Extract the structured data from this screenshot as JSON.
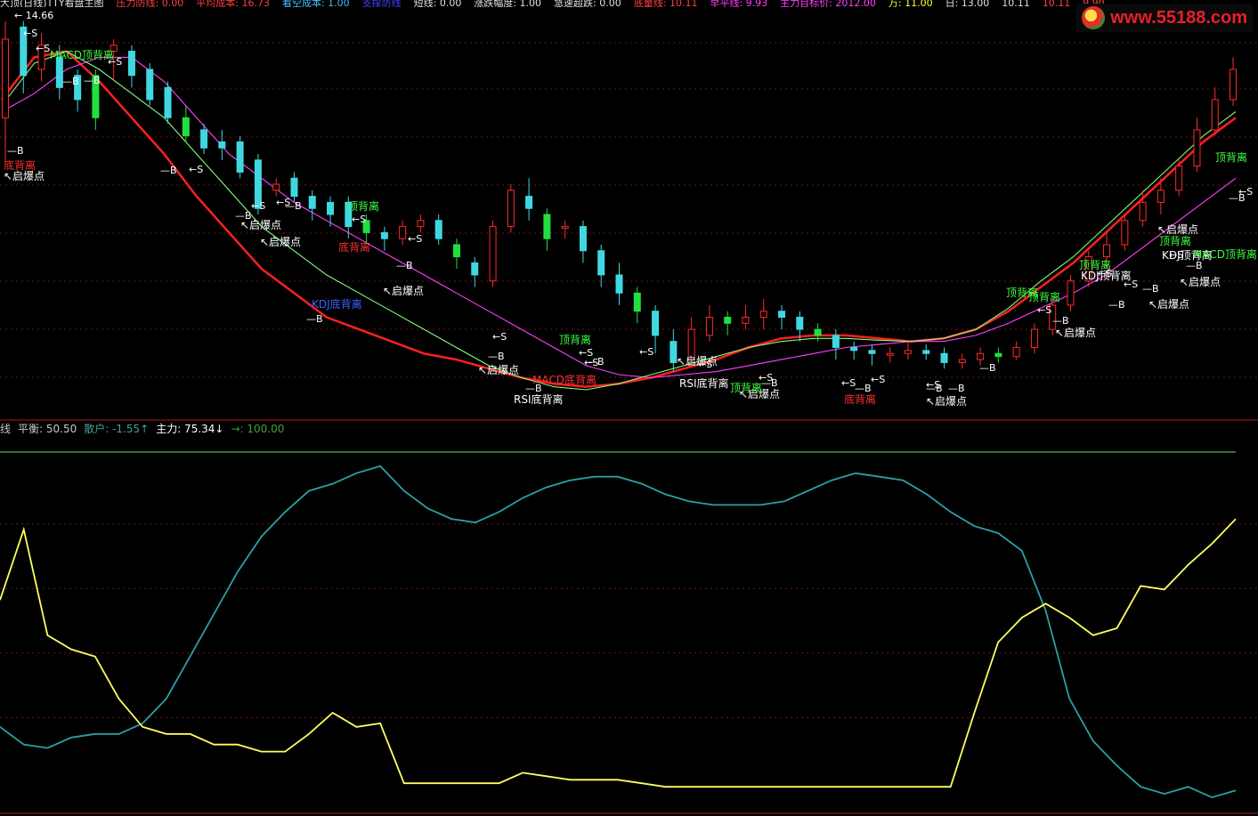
{
  "top_bar": [
    {
      "text": "大顶(日线)TTY看盘主图",
      "color": "#e0e0e0"
    },
    {
      "text": "压力防线: 0.00",
      "color": "#ff4040"
    },
    {
      "text": "平均成本: 16.73",
      "color": "#ff4040"
    },
    {
      "text": "看空成本: 1.00",
      "color": "#40c0ff"
    },
    {
      "text": "支撑防线",
      "color": "#4040ff"
    },
    {
      "text": "短线: 0.00",
      "color": "#e0e0e0"
    },
    {
      "text": "涨跌幅度: 1.00",
      "color": "#e0e0e0"
    },
    {
      "text": "急速超跌: 0.00",
      "color": "#e0e0e0"
    },
    {
      "text": "底量线: 10.11",
      "color": "#ff4040"
    },
    {
      "text": "早平线: 9.93",
      "color": "#ff40ff"
    },
    {
      "text": "主力目标价: 2012.00",
      "color": "#ff40ff"
    },
    {
      "text": "万: 11.00",
      "color": "#ffff40"
    },
    {
      "text": "日: 13.00",
      "color": "#e0e0e0"
    },
    {
      "text": "10.11",
      "color": "#e0e0e0"
    },
    {
      "text": "10.11",
      "color": "#ff4040"
    },
    {
      "text": "9.90",
      "color": "#ff4040"
    }
  ],
  "logo": {
    "text": "www.55188.com"
  },
  "chart_data": [
    {
      "type": "candlestick",
      "price_label": "14.66",
      "series": [
        {
          "name": "",
          "color": "#ff2020",
          "values": [
            12.9,
            13.6,
            13.7,
            13.2,
            12.6,
            12.0,
            11.3,
            10.7,
            10.1,
            9.7,
            9.3,
            9.1,
            8.9,
            8.7,
            8.6,
            8.45,
            8.3,
            8.2,
            8.15,
            8.2,
            8.3,
            8.45,
            8.6,
            8.8,
            8.95,
            9.0,
            9.0,
            8.95,
            8.9,
            8.95,
            9.1,
            9.4,
            9.8,
            10.2,
            10.7,
            11.2,
            11.7,
            12.2,
            12.6
          ]
        },
        {
          "name": "",
          "color": "#ff40ff",
          "values": [
            12.7,
            13.0,
            13.4,
            13.6,
            13.6,
            13.2,
            12.6,
            12.0,
            11.6,
            11.2,
            10.9,
            10.6,
            10.3,
            10.0,
            9.7,
            9.4,
            9.1,
            8.8,
            8.5,
            8.35,
            8.3,
            8.35,
            8.4,
            8.5,
            8.6,
            8.7,
            8.8,
            8.85,
            8.9,
            8.9,
            9.0,
            9.2,
            9.45,
            9.7,
            10.0,
            10.4,
            10.8,
            11.2,
            11.6
          ]
        },
        {
          "name": "",
          "color": "#80ff80",
          "values": [
            12.8,
            13.5,
            13.7,
            13.4,
            13.0,
            12.6,
            12.0,
            11.4,
            10.8,
            10.4,
            10.0,
            9.7,
            9.4,
            9.1,
            8.8,
            8.5,
            8.3,
            8.15,
            8.1,
            8.2,
            8.35,
            8.5,
            8.65,
            8.8,
            8.9,
            8.95,
            8.95,
            8.92,
            8.9,
            8.95,
            9.1,
            9.45,
            9.9,
            10.3,
            10.8,
            11.3,
            11.8,
            12.3,
            12.7
          ]
        }
      ],
      "candles": [
        [
          12.6,
          13.9,
          11.8,
          14.2
        ],
        [
          14.1,
          13.3,
          13.0,
          14.2
        ],
        [
          13.4,
          13.8,
          13.2,
          14.0
        ],
        [
          13.6,
          13.1,
          12.9,
          13.8
        ],
        [
          13.3,
          12.9,
          12.7,
          13.4
        ],
        [
          13.3,
          12.6,
          12.4,
          13.4
        ],
        [
          13.7,
          13.8,
          13.2,
          13.9
        ],
        [
          13.7,
          13.3,
          13.1,
          13.8
        ],
        [
          13.4,
          12.9,
          12.8,
          13.5
        ],
        [
          13.1,
          12.6,
          12.5,
          13.2
        ],
        [
          12.6,
          12.3,
          12.2,
          12.8
        ],
        [
          12.4,
          12.1,
          12.0,
          12.5
        ],
        [
          12.2,
          12.1,
          11.9,
          12.4
        ],
        [
          12.2,
          11.7,
          11.6,
          12.3
        ],
        [
          11.9,
          11.1,
          11.0,
          12.0
        ],
        [
          11.4,
          11.5,
          11.3,
          11.6
        ],
        [
          11.6,
          11.3,
          11.2,
          11.7
        ],
        [
          11.3,
          11.1,
          10.9,
          11.4
        ],
        [
          11.2,
          11.0,
          10.8,
          11.3
        ],
        [
          11.2,
          10.8,
          10.6,
          11.3
        ],
        [
          10.9,
          10.7,
          10.5,
          11.0
        ],
        [
          10.7,
          10.6,
          10.4,
          10.8
        ],
        [
          10.6,
          10.8,
          10.5,
          10.9
        ],
        [
          10.8,
          10.9,
          10.7,
          11.0
        ],
        [
          10.9,
          10.6,
          10.5,
          11.0
        ],
        [
          10.5,
          10.3,
          10.1,
          10.6
        ],
        [
          10.2,
          10.0,
          9.8,
          10.3
        ],
        [
          9.9,
          10.8,
          9.8,
          10.9
        ],
        [
          10.8,
          11.4,
          10.7,
          11.5
        ],
        [
          11.3,
          11.1,
          10.9,
          11.6
        ],
        [
          11.0,
          10.6,
          10.4,
          11.1
        ],
        [
          10.8,
          10.8,
          10.6,
          10.9
        ],
        [
          10.8,
          10.4,
          10.2,
          10.9
        ],
        [
          10.4,
          10.0,
          9.8,
          10.5
        ],
        [
          10.0,
          9.7,
          9.5,
          10.2
        ],
        [
          9.7,
          9.4,
          9.2,
          9.8
        ],
        [
          9.4,
          9.0,
          8.7,
          9.5
        ],
        [
          8.9,
          8.55,
          8.4,
          9.1
        ],
        [
          8.6,
          9.1,
          8.5,
          9.3
        ],
        [
          9.0,
          9.3,
          8.9,
          9.5
        ],
        [
          9.3,
          9.2,
          9.0,
          9.4
        ],
        [
          9.2,
          9.3,
          9.1,
          9.5
        ],
        [
          9.3,
          9.4,
          9.1,
          9.6
        ],
        [
          9.4,
          9.3,
          9.1,
          9.5
        ],
        [
          9.3,
          9.1,
          8.9,
          9.4
        ],
        [
          9.1,
          9.0,
          8.9,
          9.2
        ],
        [
          9.0,
          8.8,
          8.6,
          9.1
        ],
        [
          8.8,
          8.75,
          8.6,
          8.9
        ],
        [
          8.75,
          8.7,
          8.5,
          8.85
        ],
        [
          8.7,
          8.7,
          8.55,
          8.8
        ],
        [
          8.7,
          8.75,
          8.6,
          8.9
        ],
        [
          8.75,
          8.7,
          8.6,
          8.85
        ],
        [
          8.7,
          8.55,
          8.45,
          8.8
        ],
        [
          8.55,
          8.6,
          8.45,
          8.7
        ],
        [
          8.6,
          8.7,
          8.5,
          8.8
        ],
        [
          8.7,
          8.65,
          8.55,
          8.8
        ],
        [
          8.65,
          8.8,
          8.6,
          8.9
        ],
        [
          8.8,
          9.1,
          8.7,
          9.2
        ],
        [
          9.1,
          9.5,
          9.0,
          9.6
        ],
        [
          9.5,
          9.9,
          9.4,
          10.0
        ],
        [
          9.9,
          10.3,
          9.8,
          10.4
        ],
        [
          10.3,
          10.5,
          10.1,
          10.7
        ],
        [
          10.5,
          10.9,
          10.4,
          11.0
        ],
        [
          10.9,
          11.2,
          10.8,
          11.4
        ],
        [
          11.2,
          11.4,
          11.0,
          11.6
        ],
        [
          11.4,
          11.8,
          11.3,
          11.9
        ],
        [
          11.8,
          12.4,
          11.7,
          12.6
        ],
        [
          12.4,
          12.9,
          12.3,
          13.1
        ],
        [
          12.9,
          13.4,
          12.8,
          13.6
        ]
      ],
      "annotations": [
        {
          "text": "MACD顶背离",
          "color": "#40ff40"
        },
        {
          "text": "顶背离",
          "color": "#40ff40"
        },
        {
          "text": "底背离",
          "color": "#ff3030"
        },
        {
          "text": "启爆点",
          "color": "#ffffff"
        },
        {
          "text": "启爆点",
          "color": "#ffffff"
        },
        {
          "text": "启爆点",
          "color": "#ffffff"
        },
        {
          "text": "启爆点",
          "color": "#ffffff"
        },
        {
          "text": "启爆点",
          "color": "#ffffff"
        },
        {
          "text": "KDJ底背离",
          "color": "#4060ff"
        },
        {
          "text": "顶背离",
          "color": "#40ff40"
        },
        {
          "text": "底背离",
          "color": "#ff3030"
        },
        {
          "text": "启爆点",
          "color": "#ffffff"
        },
        {
          "text": "顶背离",
          "color": "#40ff40"
        },
        {
          "text": "MACD底背离",
          "color": "#ff3030"
        },
        {
          "text": "启爆点",
          "color": "#ffffff"
        },
        {
          "text": "RSI底背离",
          "color": "#ffffff"
        },
        {
          "text": "RSI底背离",
          "color": "#ffffff"
        },
        {
          "text": "启爆点",
          "color": "#ffffff"
        },
        {
          "text": "启爆点",
          "color": "#ffffff"
        },
        {
          "text": "底背离",
          "color": "#ff3030"
        },
        {
          "text": "顶背离",
          "color": "#40ff40"
        },
        {
          "text": "顶背离",
          "color": "#40ff40"
        },
        {
          "text": "启爆点",
          "color": "#ffffff"
        },
        {
          "text": "顶背离",
          "color": "#40ff40"
        },
        {
          "text": "KDJ顶背离",
          "color": "#ffffff"
        },
        {
          "text": "启爆点",
          "color": "#ffffff"
        },
        {
          "text": "顶背离",
          "color": "#40ff40"
        },
        {
          "text": "KDJ顶背离",
          "color": "#ffffff"
        },
        {
          "text": "MACD顶背离",
          "color": "#40ff40"
        },
        {
          "text": "启爆点",
          "color": "#ffffff"
        },
        {
          "text": "顶背离",
          "color": "#40ff40"
        }
      ],
      "signals_b": [
        "B",
        "B",
        "B",
        "B",
        "B",
        "B",
        "B",
        "B",
        "B",
        "B",
        "B",
        "B",
        "B",
        "B",
        "B",
        "B",
        "B",
        "B",
        "B",
        "B",
        "B"
      ],
      "signals_s": [
        "S",
        "S",
        "S",
        "S",
        "S",
        "S",
        "S",
        "S",
        "S",
        "S",
        "S",
        "S",
        "S",
        "S",
        "S",
        "S",
        "S",
        "S",
        "S",
        "S",
        "S",
        "S"
      ]
    },
    {
      "type": "line",
      "ylim": [
        0,
        100
      ],
      "legend": [
        {
          "text": "线",
          "color": "#c8c8c8"
        },
        {
          "text": "平衡: 50.50",
          "color": "#c8c8c8"
        },
        {
          "text": "散户: -1.55↑",
          "color": "#40a0a0"
        },
        {
          "text": "主力: 75.34↓",
          "color": "#ffffff"
        },
        {
          "text": "→: 100.00",
          "color": "#40a040"
        }
      ],
      "reference_line": 100,
      "series": [
        {
          "name": "散户",
          "color": "#2aa0a8",
          "values": [
            22,
            17,
            16,
            19,
            20,
            20,
            23,
            30,
            42,
            54,
            66,
            76,
            83,
            89,
            91,
            94,
            96,
            89,
            84,
            81,
            80,
            83,
            87,
            90,
            92,
            93,
            93,
            91,
            88,
            86,
            85,
            85,
            85,
            86,
            89,
            92,
            94,
            93,
            92,
            88,
            83,
            79,
            77,
            72,
            55,
            30,
            18,
            11,
            5,
            3,
            5,
            2,
            4
          ]
        },
        {
          "name": "主力",
          "color": "#ffff60",
          "values": [
            58,
            78,
            48,
            44,
            42,
            30,
            22,
            20,
            20,
            17,
            17,
            15,
            15,
            20,
            26,
            22,
            23,
            6,
            6,
            6,
            6,
            6,
            9,
            8,
            7,
            7,
            7,
            6,
            5,
            5,
            5,
            5,
            5,
            5,
            5,
            5,
            5,
            5,
            5,
            5,
            5,
            26,
            46,
            53,
            57,
            53,
            48,
            50,
            62,
            61,
            68,
            74,
            81
          ]
        }
      ]
    }
  ]
}
